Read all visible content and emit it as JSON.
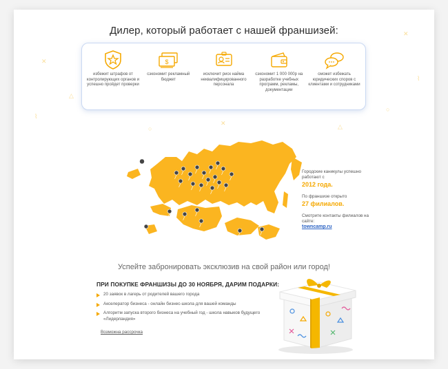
{
  "title": "Дилер, который работает с нашей франшизей:",
  "benefits": [
    {
      "icon": "star-badge-icon",
      "text": "избежит штрафов от контролирующих органов и успешно пройдет проверки"
    },
    {
      "icon": "money-bills-icon",
      "text": "сэкономит рекламный бюджет"
    },
    {
      "icon": "id-card-icon",
      "text": "исключит риск найма неквалифицированного персонала"
    },
    {
      "icon": "wallet-icon",
      "text": "сэкономит 1 000 000р на разработке учебных программ, рекламы, документации"
    },
    {
      "icon": "chat-bubbles-icon",
      "text": "сможет избежать юридических споров с клиентами и сотрудниками"
    }
  ],
  "stats": {
    "line1": "Городские каникулы успешно работают с",
    "year": "2012 года.",
    "line2": "По франшизе открыто",
    "branches": "27 филиалов.",
    "line3": "Смотрите контакты филиалов на сайте:",
    "site": "towncamp.ru"
  },
  "cta": "Успейте забронировать эксклюзив на свой район или город!",
  "gifts": {
    "heading": "ПРИ ПОКУПКЕ ФРАНШИЗЫ ДО 30 НОЯБРЯ, ДАРИМ ПОДАРКИ:",
    "items": [
      "20 заявок в лагерь от родителей вашего города",
      "Акселератор бизнеса - онлайн бизнес-школа для вашей команды",
      "Алгоритм запуска второго бизнеса на учебный год - школа навыков будущего «Лидерландия»"
    ],
    "installment": "Возможна рассрочка"
  },
  "colors": {
    "accent": "#f5a800",
    "map": "#fbb520",
    "link": "#2b63c4",
    "card_border": "#c9d8f2"
  }
}
